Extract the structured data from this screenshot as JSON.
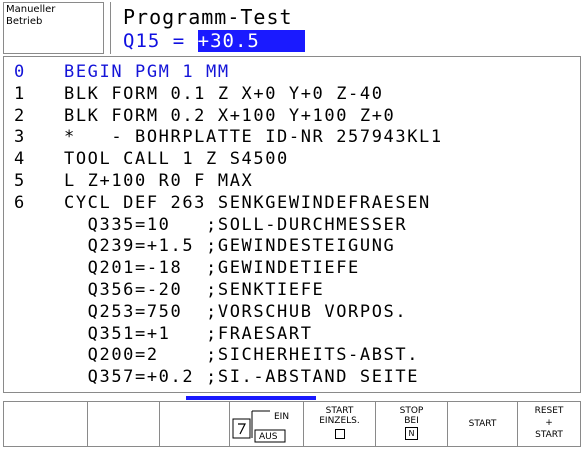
{
  "header": {
    "mode_line1": "Manueller",
    "mode_line2": "Betrieb",
    "title": "Programm-Test",
    "q_param": "Q15 =",
    "q_value": "+30.5"
  },
  "program": {
    "lines": [
      {
        "num": "0",
        "code": "BEGIN PGM 1 MM"
      },
      {
        "num": "1",
        "code": "BLK FORM 0.1 Z X+0 Y+0 Z-40"
      },
      {
        "num": "2",
        "code": "BLK FORM 0.2 X+100 Y+100 Z+0"
      },
      {
        "num": "3",
        "code": "*   - BOHRPLATTE ID-NR 257943KL1"
      },
      {
        "num": "4",
        "code": "TOOL CALL 1 Z S4500"
      },
      {
        "num": "5",
        "code": "L Z+100 R0 F MAX"
      },
      {
        "num": "6",
        "code": "CYCL DEF 263 SENKGEWINDEFRAESEN"
      },
      {
        "num": "",
        "code": "  Q335=10   ;SOLL-DURCHMESSER"
      },
      {
        "num": "",
        "code": "  Q239=+1.5 ;GEWINDESTEIGUNG"
      },
      {
        "num": "",
        "code": "  Q201=-18  ;GEWINDETIEFE"
      },
      {
        "num": "",
        "code": "  Q356=-20  ;SENKTIEFE"
      },
      {
        "num": "",
        "code": "  Q253=750  ;VORSCHUB VORPOS."
      },
      {
        "num": "",
        "code": "  Q351=+1   ;FRAESART"
      },
      {
        "num": "",
        "code": "  Q200=2    ;SICHERHEITS-ABST."
      },
      {
        "num": "",
        "code": "  Q357=+0.2 ;SI.-ABSTAND SEITE"
      }
    ]
  },
  "softkeys": {
    "ein": "EIN",
    "aus": "AUS",
    "start_einzels_1": "START",
    "start_einzels_2": "EINZELS.",
    "stop_bei_1": "STOP",
    "stop_bei_2": "BEI",
    "stop_bei_3": "N",
    "start": "START",
    "reset_1": "RESET",
    "reset_2": "+",
    "reset_3": "START"
  },
  "colors": {
    "highlight": "#1a1aff",
    "first_line": "#1414d8",
    "border": "#8a8a8a"
  }
}
